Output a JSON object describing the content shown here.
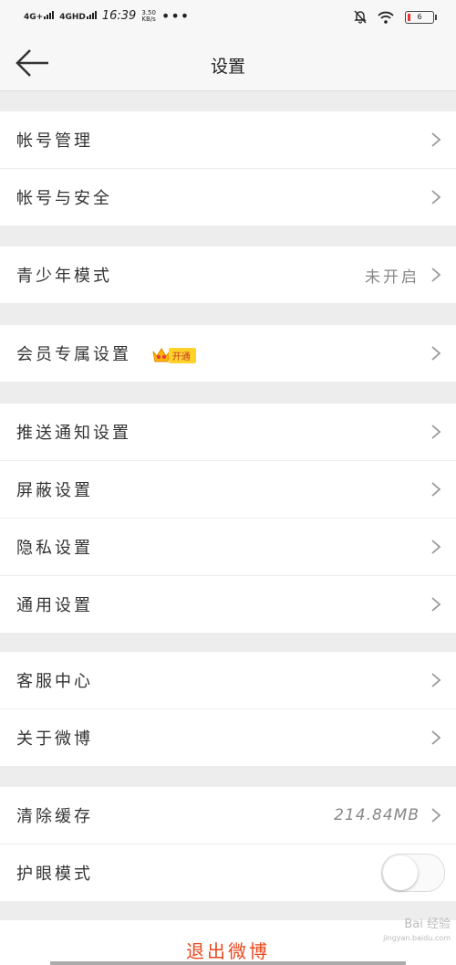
{
  "status_bar": {
    "sim1": "4G+",
    "sim2": "4GHD",
    "time": "16:39",
    "speed_value": "3.50",
    "speed_unit": "KB/s",
    "more": "•••",
    "battery": "6"
  },
  "header": {
    "title": "设置"
  },
  "groups": [
    {
      "items": [
        {
          "label": "帐号管理"
        },
        {
          "label": "帐号与安全"
        }
      ]
    },
    {
      "items": [
        {
          "label": "青少年模式",
          "value": "未开启"
        }
      ]
    },
    {
      "items": [
        {
          "label": "会员专属设置",
          "badge": "开通"
        }
      ]
    },
    {
      "items": [
        {
          "label": "推送通知设置"
        },
        {
          "label": "屏蔽设置"
        },
        {
          "label": "隐私设置"
        },
        {
          "label": "通用设置"
        }
      ]
    },
    {
      "items": [
        {
          "label": "客服中心"
        },
        {
          "label": "关于微博"
        }
      ]
    },
    {
      "items": [
        {
          "label": "清除缓存",
          "value": "214.84MB"
        },
        {
          "label": "护眼模式",
          "toggle_on": false
        }
      ]
    }
  ],
  "logout_label": "退出微博",
  "watermark": {
    "text": "Bai 经验",
    "url": "jingyan.baidu.com"
  },
  "colors": {
    "accent": "#e8481c",
    "badge": "#ffd22a"
  }
}
